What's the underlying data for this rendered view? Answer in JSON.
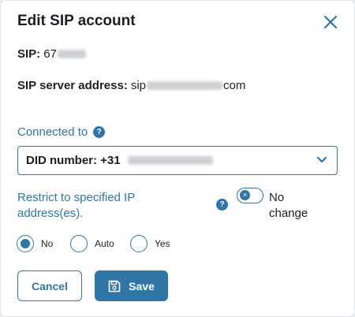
{
  "dialog": {
    "title": "Edit SIP account",
    "close_icon": "close-icon"
  },
  "sip": {
    "label": "SIP:",
    "value_visible": "67"
  },
  "server": {
    "label": "SIP server address:",
    "value_prefix": "sip",
    "value_suffix": "com"
  },
  "connected": {
    "label": "Connected to",
    "help_glyph": "?",
    "select_prefix": "DID number: +31"
  },
  "restrict": {
    "label": "Restrict to specified IP address(es).",
    "help_glyph": "?",
    "toggle_glyph": "×",
    "toggle_text": "No change"
  },
  "radio_options": [
    {
      "label": "No",
      "selected": true
    },
    {
      "label": "Auto",
      "selected": false
    },
    {
      "label": "Yes",
      "selected": false
    }
  ],
  "buttons": {
    "cancel": "Cancel",
    "save": "Save"
  },
  "colors": {
    "accent": "#2f76a6",
    "text": "#1b1f24",
    "background": "#ffffff"
  }
}
